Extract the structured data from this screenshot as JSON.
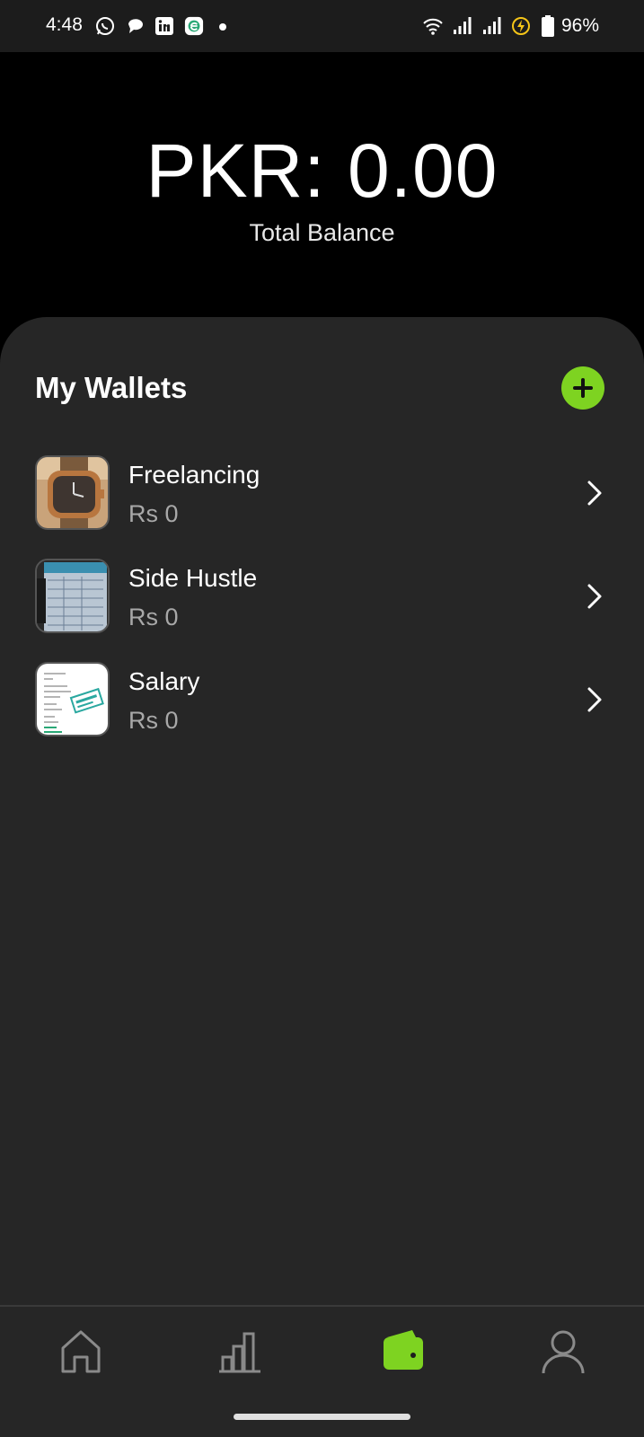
{
  "status_bar": {
    "time": "4:48",
    "battery_percent": "96%",
    "icons": [
      "whatsapp-icon",
      "chat-bubble-icon",
      "linkedin-icon",
      "e-app-icon",
      "wifi-icon",
      "signal-icon",
      "signal-icon",
      "charging-icon",
      "battery-icon"
    ]
  },
  "header": {
    "balance": "PKR: 0.00",
    "balance_label": "Total Balance"
  },
  "wallets": {
    "title": "My Wallets",
    "items": [
      {
        "name": "Freelancing",
        "amount": "Rs 0",
        "thumbnail": "watch-photo"
      },
      {
        "name": "Side Hustle",
        "amount": "Rs 0",
        "thumbnail": "receipt-photo"
      },
      {
        "name": "Salary",
        "amount": "Rs 0",
        "thumbnail": "bill-paid-document"
      }
    ]
  },
  "bottom_nav": {
    "items": [
      "home-icon",
      "stats-icon",
      "wallet-icon",
      "profile-icon"
    ],
    "active": "wallet-icon"
  },
  "colors": {
    "accent": "#7ed321",
    "sheet_bg": "#262626",
    "header_bg": "#000000",
    "muted_text": "#a8a8a8"
  }
}
